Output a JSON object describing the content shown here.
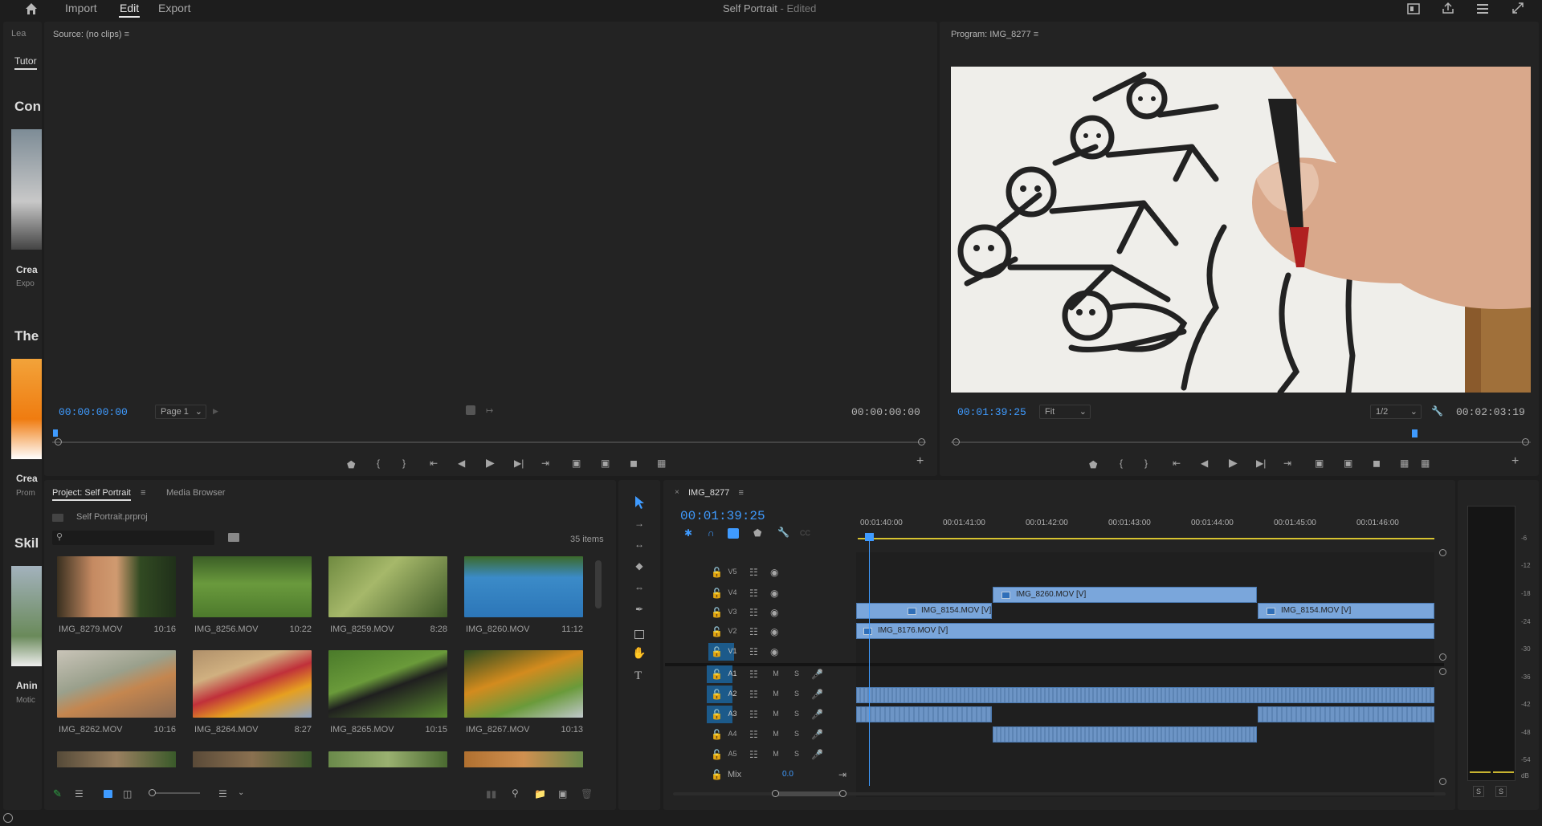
{
  "topbar": {
    "tabs": [
      "Import",
      "Edit",
      "Export"
    ],
    "active_tab": "Edit",
    "project_title": "Self Portrait",
    "edited": "- Edited"
  },
  "learn": {
    "tab1": "Lea",
    "tab2": "Tutor",
    "s1_head": "Con",
    "s1_title": "Crea",
    "s1_sub": "Expo",
    "s2_head": "The",
    "s2_title": "Crea",
    "s2_sub": "Prom",
    "s3_head": "Skil",
    "s3_title": "Anin",
    "s3_sub": "Motic"
  },
  "source": {
    "title": "Source: (no clips)",
    "tc_in": "00:00:00:00",
    "page": "Page 1",
    "tc_out": "00:00:00:00"
  },
  "program": {
    "title": "Program: IMG_8277",
    "tc_in": "00:01:39:25",
    "fit": "Fit",
    "res": "1/2",
    "tc_out": "00:02:03:19"
  },
  "project": {
    "tab_project": "Project: Self Portrait",
    "tab_media": "Media Browser",
    "file": "Self Portrait.prproj",
    "search_placeholder": "",
    "count": "35 items",
    "items": [
      {
        "name": "IMG_8279.MOV",
        "dur": "10:16"
      },
      {
        "name": "IMG_8256.MOV",
        "dur": "10:22"
      },
      {
        "name": "IMG_8259.MOV",
        "dur": "8:28"
      },
      {
        "name": "IMG_8260.MOV",
        "dur": "11:12"
      },
      {
        "name": "IMG_8262.MOV",
        "dur": "10:16"
      },
      {
        "name": "IMG_8264.MOV",
        "dur": "8:27"
      },
      {
        "name": "IMG_8265.MOV",
        "dur": "10:15"
      },
      {
        "name": "IMG_8267.MOV",
        "dur": "10:13"
      }
    ]
  },
  "timeline": {
    "seq_name": "IMG_8277",
    "tc": "00:01:39:25",
    "ruler": [
      "00:01:40:00",
      "00:01:41:00",
      "00:01:42:00",
      "00:01:43:00",
      "00:01:44:00",
      "00:01:45:00",
      "00:01:46:00"
    ],
    "video_tracks": [
      "V5",
      "V4",
      "V3",
      "V2",
      "V1"
    ],
    "audio_tracks": [
      "A1",
      "A2",
      "A3",
      "A4",
      "A5"
    ],
    "mix_label": "Mix",
    "mix_value": "0.0",
    "clips": {
      "v4": "IMG_8260.MOV [V]",
      "v3a": "IMG_8154.MOV [V]",
      "v3b": "IMG_8154.MOV [V]",
      "v2": "IMG_8176.MOV [V]"
    },
    "m": "M",
    "s": "S"
  },
  "meter": {
    "labels": [
      "-6",
      "-12",
      "-18",
      "-24",
      "-30",
      "-36",
      "-42",
      "-48",
      "-54"
    ],
    "db": "dB",
    "solo": [
      "S",
      "S"
    ]
  }
}
